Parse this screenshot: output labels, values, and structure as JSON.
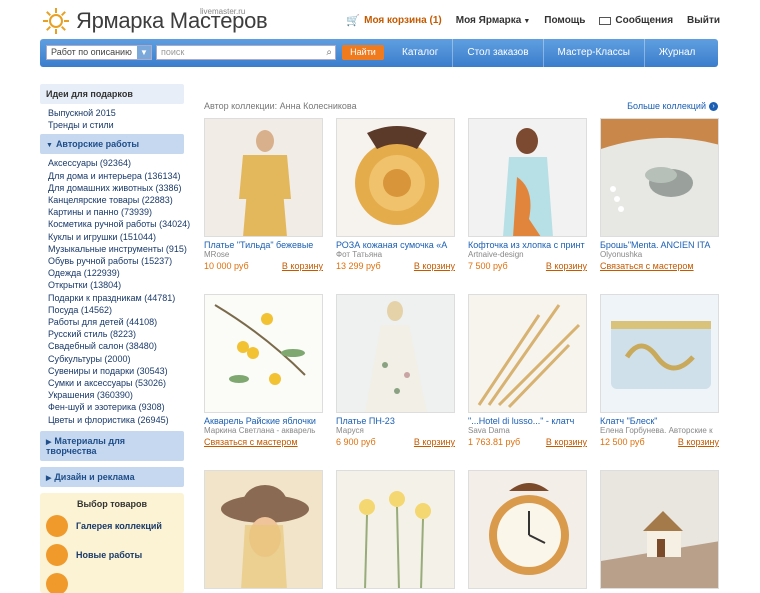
{
  "header": {
    "logo_title": "Ярмарка Мастеров",
    "logo_sub": "livemaster.ru",
    "nav": {
      "cart": "Моя корзина (1)",
      "my_fair": "Моя Ярмарка",
      "help": "Помощь",
      "messages": "Сообщения",
      "logout": "Выйти"
    }
  },
  "searchbar": {
    "select_value": "Работ по описанию",
    "placeholder": "поиск",
    "find_label": "Найти",
    "menu": [
      "Каталог",
      "Стол заказов",
      "Мастер-Классы",
      "Журнал"
    ]
  },
  "sidebar": {
    "ideas_title": "Идеи для подарков",
    "ideas": [
      "Выпускной 2015",
      "Тренды и стили"
    ],
    "author_title": "Авторские работы",
    "author_items": [
      "Аксессуары (92364)",
      "Для дома и интерьера (136134)",
      "Для домашних животных (3386)",
      "Канцелярские товары (22883)",
      "Картины и панно (73939)",
      "Косметика ручной работы (34024)",
      "Куклы и игрушки (151044)",
      "Музыкальные инструменты (915)",
      "Обувь ручной работы (15237)",
      "Одежда (122939)",
      "Открытки (13804)",
      "Подарки к праздникам (44781)",
      "Посуда (14562)",
      "Работы для детей (44108)",
      "Русский стиль (8223)",
      "Свадебный салон (38480)",
      "Субкультуры (2000)",
      "Сувениры и подарки (30543)",
      "Сумки и аксессуары (53026)",
      "Украшения (360390)",
      "Фен-шуй и эзотерика (9308)",
      "Цветы и флористика (26945)"
    ],
    "materials_title": "Материалы для творчества",
    "design_title": "Дизайн и реклама",
    "select_title": "Выбор товаров",
    "select_items": [
      "Галерея коллекций",
      "Новые работы"
    ]
  },
  "main": {
    "author": "Автор коллекции: Анна Колесникова",
    "more": "Больше коллекций",
    "cards": [
      {
        "title": "Платье \"Тильда\" бежевые",
        "seller": "MRose",
        "price": "10 000 руб",
        "action": "В корзину",
        "buy": true
      },
      {
        "title": "РОЗА кожаная сумочка «А",
        "seller": "Фот Татьяна",
        "price": "13 299 руб",
        "action": "В корзину",
        "buy": true
      },
      {
        "title": "Кофточка из хлопка с принт",
        "seller": "Artnaive-design",
        "price": "7 500 руб",
        "action": "В корзину",
        "buy": true
      },
      {
        "title": "Брошь\"Menta. ANCIEN ITA",
        "seller": "Olyonushka",
        "price": "",
        "action": "Связаться с мастером",
        "buy": false
      },
      {
        "title": "Акварель Райские яблочки",
        "seller": "Маркина Светлана - акварель",
        "price": "",
        "action": "Связаться с мастером",
        "buy": false
      },
      {
        "title": "Платье ПН-23",
        "seller": "Маруся",
        "price": "6 900 руб",
        "action": "В корзину",
        "buy": true
      },
      {
        "title": "\"...Hotel di lusso...\" - клатч",
        "seller": "Sava Dama",
        "price": "1 763.81 руб",
        "action": "В корзину",
        "buy": true
      },
      {
        "title": "Клатч \"Блеск\"",
        "seller": "Елена Горбунева. Авторские к",
        "price": "12 500 руб",
        "action": "В корзину",
        "buy": true
      },
      {
        "title": "",
        "seller": "",
        "price": "",
        "action": "",
        "buy": false
      },
      {
        "title": "",
        "seller": "",
        "price": "",
        "action": "",
        "buy": false
      },
      {
        "title": "",
        "seller": "",
        "price": "",
        "action": "",
        "buy": false
      },
      {
        "title": "",
        "seller": "",
        "price": "",
        "action": "",
        "buy": false
      }
    ]
  },
  "colors": {
    "brand_blue": "#3b7dcc",
    "accent_orange": "#f07b1f",
    "link_blue": "#1a5fb4",
    "price_orange": "#e0700c"
  }
}
